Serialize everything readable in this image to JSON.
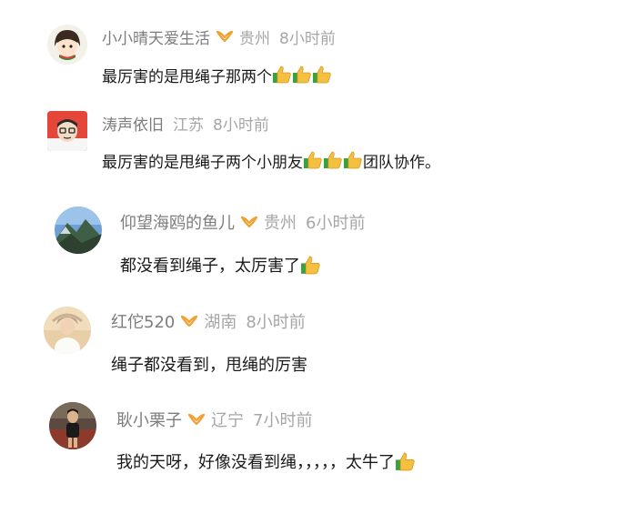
{
  "comments": [
    {
      "name": "小小晴天爱生活",
      "has_badge": true,
      "location": "贵州",
      "time": "8小时前",
      "text_before": "最厉害的是甩绳子那两个",
      "thumbs": 3,
      "text_after": "",
      "avatar_icon": "cartoon-girl-avatar"
    },
    {
      "name": "涛声依旧",
      "has_badge": false,
      "location": "江苏",
      "time": "8小时前",
      "text_before": "最厉害的是甩绳子两个小朋友",
      "thumbs": 3,
      "text_after": "团队协作。",
      "avatar_icon": "cartoon-man-avatar"
    },
    {
      "name": "仰望海鸥的鱼儿",
      "has_badge": true,
      "location": "贵州",
      "time": "6小时前",
      "text_before": "都没看到绳子，太厉害了",
      "thumbs": 1,
      "text_after": "",
      "avatar_icon": "mountain-photo-avatar"
    },
    {
      "name": "红佗520",
      "has_badge": true,
      "location": "湖南",
      "time": "8小时前",
      "text_before": "绳子都没看到，甩绳的厉害",
      "thumbs": 0,
      "text_after": "",
      "avatar_icon": "woman-photo-avatar"
    },
    {
      "name": "耿小栗子",
      "has_badge": true,
      "location": "辽宁",
      "time": "7小时前",
      "text_before": "我的天呀，好像没看到绳，，，，，太牛了",
      "thumbs": 1,
      "text_after": "",
      "avatar_icon": "person-photo-avatar"
    }
  ],
  "colors": {
    "badge": "#f0a030",
    "meta_text": "#8a8a8a",
    "body_text": "#1a1a1a",
    "thumb": "#f5c040",
    "thumb_cuff": "#3aa040"
  }
}
